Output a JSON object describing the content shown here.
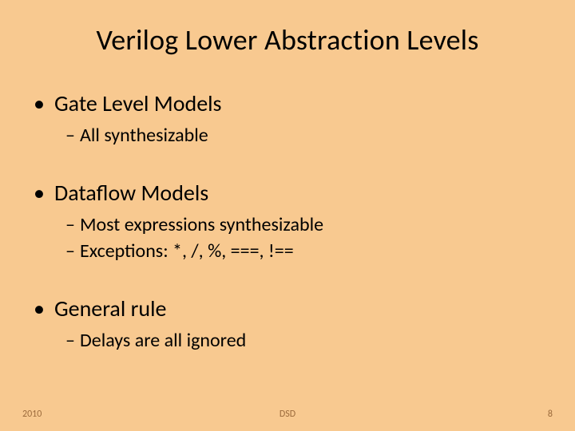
{
  "title": "Verilog Lower Abstraction Levels",
  "sections": [
    {
      "heading": "Gate Level Models",
      "items": [
        "All synthesizable"
      ]
    },
    {
      "heading": "Dataflow Models",
      "items": [
        "Most expressions synthesizable",
        "Exceptions: *, /, %, ===, !=="
      ]
    },
    {
      "heading": "General rule",
      "items": [
        "Delays are all ignored"
      ]
    }
  ],
  "footer": {
    "left": "2010",
    "center": "DSD",
    "right": "8"
  }
}
